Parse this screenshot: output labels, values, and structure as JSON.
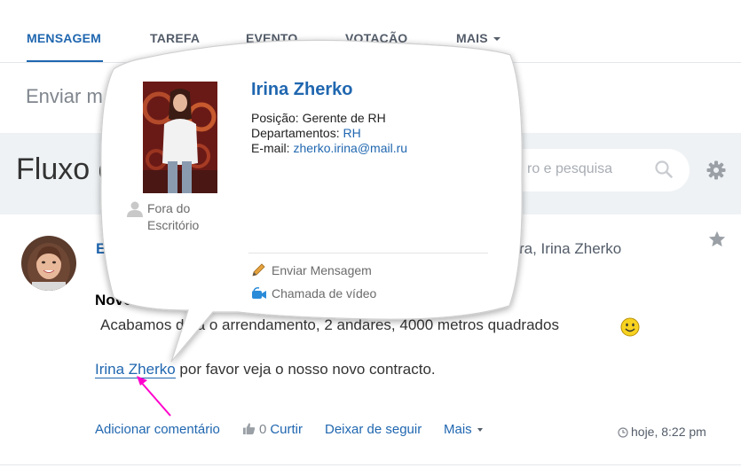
{
  "tabs": [
    {
      "label": "MENSAGEM"
    },
    {
      "label": "TAREFA"
    },
    {
      "label": "EVENTO"
    },
    {
      "label": "VOTAÇÃO"
    },
    {
      "label": "MAIS"
    }
  ],
  "compose": {
    "placeholder": "Enviar m"
  },
  "feed": {
    "title": "Fluxo d",
    "search_placeholder": "ro e pesquisa"
  },
  "post": {
    "author": "E",
    "recipients": "ra, Irina Zherko",
    "title": "Novo",
    "text": "Acabamos de a        o arrendamento, 2 andares, 4000 metros quadrados",
    "mention_name": "Irina Zherko",
    "mention_rest": " por favor veja o nosso novo contracto.",
    "actions": {
      "comment": "Adicionar comentário",
      "like_count": "0",
      "like": "Curtir",
      "unfollow": "Deixar de seguir",
      "more": "Mais"
    },
    "timestamp": "hoje, 8:22 pm"
  },
  "popup": {
    "name": "Irina Zherko",
    "position_label": "Posição:",
    "position_value": "Gerente de RH",
    "departments_label": "Departamentos:",
    "departments_value": "RH",
    "email_label": "E-mail:",
    "email_value": "zherko.irina@mail.ru",
    "status_line1": "Fora do",
    "status_line2": "Escritório",
    "send_message": "Enviar Mensagem",
    "video_call": "Chamada de vídeo"
  },
  "colors": {
    "accent": "#2067b0",
    "band": "#eef2f4",
    "arrow": "#ff00cc"
  }
}
